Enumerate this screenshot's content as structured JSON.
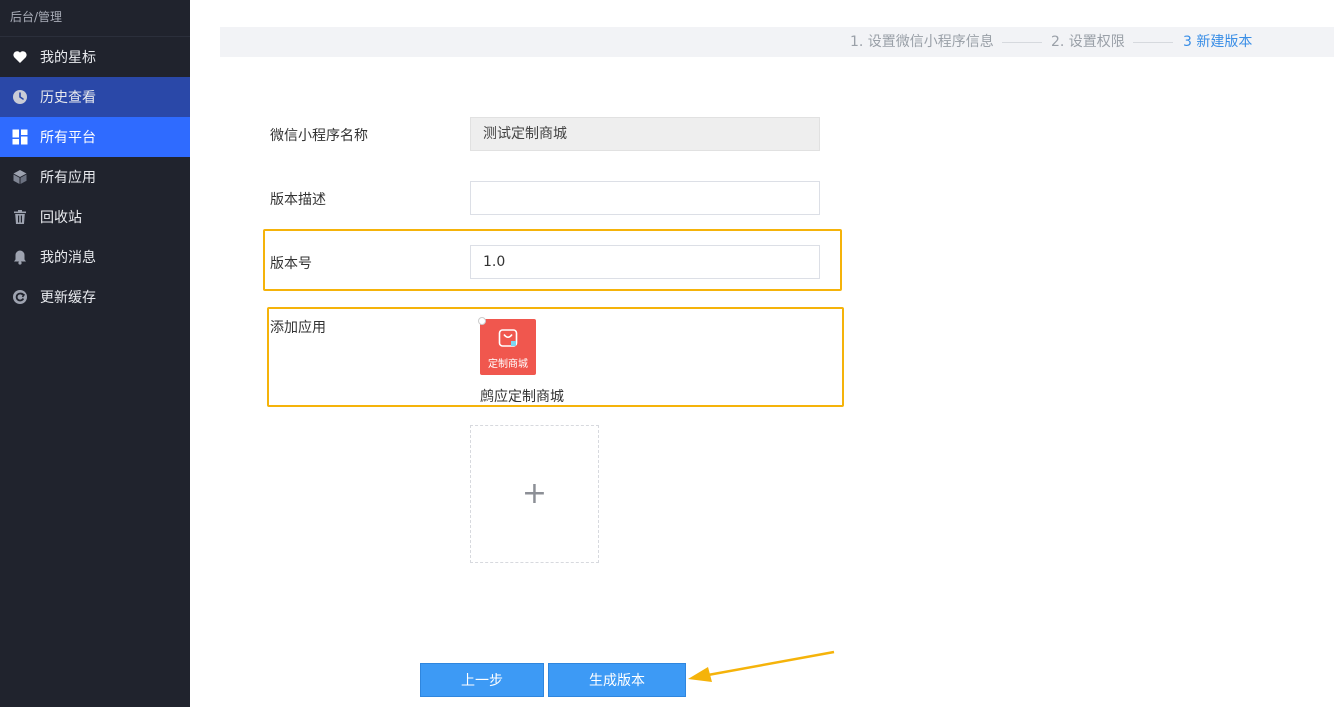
{
  "sidebar": {
    "breadcrumb": "后台/管理",
    "items": [
      {
        "label": "我的星标",
        "icon": "heart-icon"
      },
      {
        "label": "历史查看",
        "icon": "clock-icon"
      },
      {
        "label": "所有平台",
        "icon": "grid-icon"
      },
      {
        "label": "所有应用",
        "icon": "cube-icon"
      },
      {
        "label": "回收站",
        "icon": "trash-icon"
      },
      {
        "label": "我的消息",
        "icon": "bell-icon"
      },
      {
        "label": "更新缓存",
        "icon": "refresh-icon"
      }
    ]
  },
  "steps": [
    {
      "label": "1. 设置微信小程序信息"
    },
    {
      "label": "2. 设置权限"
    },
    {
      "label": "3 新建版本"
    }
  ],
  "form": {
    "name_label": "微信小程序名称",
    "name_value": "测试定制商城",
    "desc_label": "版本描述",
    "desc_value": "",
    "version_label": "版本号",
    "version_value": "1.0",
    "app_label": "添加应用",
    "app_tile_text": "定制商城",
    "app_name": "鹧应定制商城",
    "add_symbol": "+"
  },
  "buttons": {
    "prev": "上一步",
    "generate": "生成版本"
  },
  "colors": {
    "sidebar_bg": "#20232d",
    "active_nav": "#2f6bff",
    "primary_button": "#3d9af5",
    "highlight": "#f5b30a",
    "app_tile": "#f0574e",
    "active_step": "#3a8ee6"
  }
}
